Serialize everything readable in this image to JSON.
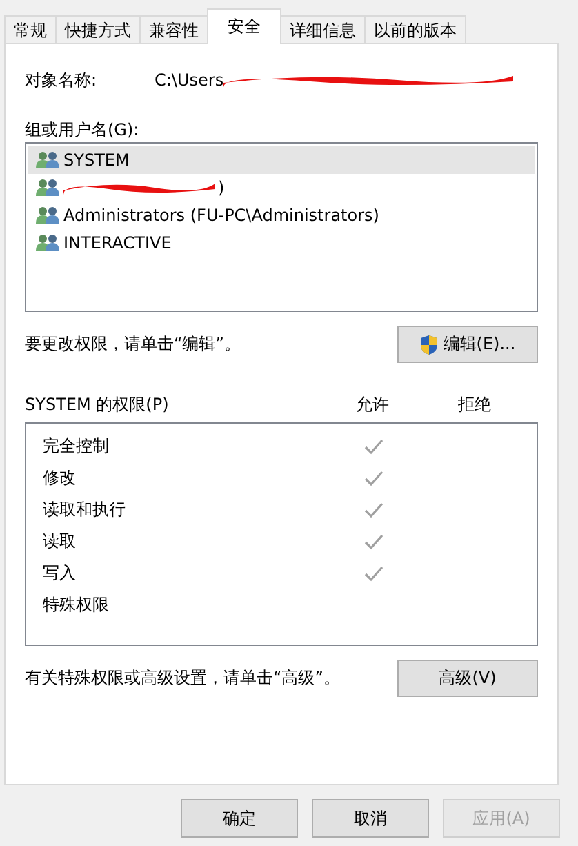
{
  "tabs": [
    {
      "label": "常规",
      "selected": false
    },
    {
      "label": "快捷方式",
      "selected": false
    },
    {
      "label": "兼容性",
      "selected": false
    },
    {
      "label": "安全",
      "selected": true
    },
    {
      "label": "详细信息",
      "selected": false
    },
    {
      "label": "以前的版本",
      "selected": false
    }
  ],
  "object_name": {
    "label": "对象名称:",
    "value": "C:\\Users",
    "redacted": true
  },
  "users": {
    "label": "组或用户名(G):",
    "items": [
      {
        "name": "SYSTEM",
        "selected": true,
        "redacted": false
      },
      {
        "name": ")",
        "selected": false,
        "redacted": true
      },
      {
        "name": "Administrators (FU-PC\\Administrators)",
        "selected": false,
        "redacted": false
      },
      {
        "name": "INTERACTIVE",
        "selected": false,
        "redacted": false
      }
    ]
  },
  "edit_hint": "要更改权限，请单击“编辑”。",
  "edit_button": "编辑(E)...",
  "permissions": {
    "label": "SYSTEM 的权限(P)",
    "allow_header": "允许",
    "deny_header": "拒绝",
    "items": [
      {
        "name": "完全控制",
        "allow": true,
        "deny": false
      },
      {
        "name": "修改",
        "allow": true,
        "deny": false
      },
      {
        "name": "读取和执行",
        "allow": true,
        "deny": false
      },
      {
        "name": "读取",
        "allow": true,
        "deny": false
      },
      {
        "name": "写入",
        "allow": true,
        "deny": false
      },
      {
        "name": "特殊权限",
        "allow": false,
        "deny": false
      }
    ]
  },
  "advanced_hint": "有关特殊权限或高级设置，请单击“高级”。",
  "advanced_button": "高级(V)",
  "buttons": [
    {
      "label": "确定",
      "disabled": false
    },
    {
      "label": "取消",
      "disabled": false
    },
    {
      "label": "应用(A)",
      "disabled": true
    }
  ]
}
